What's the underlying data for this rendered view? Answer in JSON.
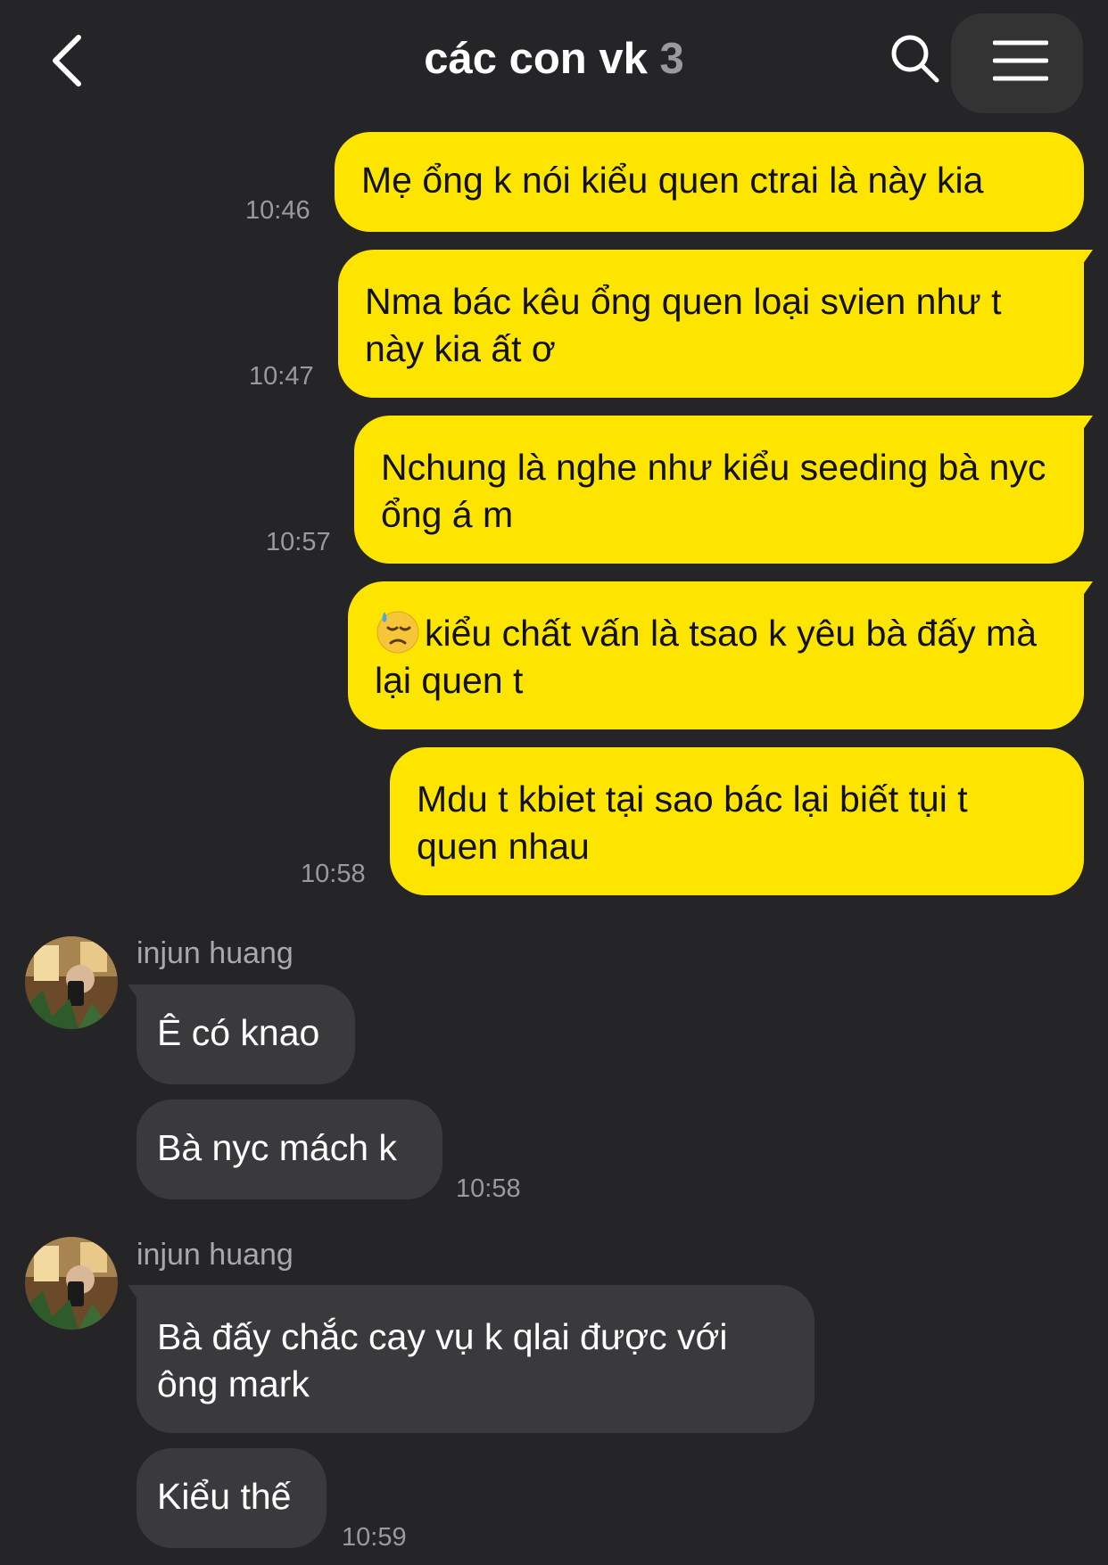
{
  "header": {
    "title": "các con vk",
    "member_count": "3",
    "back_icon": "chevron-left-icon",
    "search_icon": "search-icon",
    "menu_icon": "hamburger-menu-icon"
  },
  "colors": {
    "background": "#252527",
    "my_bubble": "#fee500",
    "their_bubble": "#3a3a3c",
    "timestamp": "#9a9a9c"
  },
  "messages": {
    "m1": {
      "text": "Mẹ ổng k nói kiểu quen ctrai là này kia",
      "time": "10:46"
    },
    "m2": {
      "text": "Nma bác kêu ổng quen loại svien như t này kia ất ơ",
      "time": "10:47"
    },
    "m3": {
      "text": "Nchung là nghe như kiểu seeding bà nyc ổng á m",
      "time": "10:57"
    },
    "m4": {
      "emoji": "downcast-face-with-sweat-emoji",
      "text": "kiểu chất vấn là tsao k yêu bà đấy mà lại quen t"
    },
    "m5": {
      "text": "Mdu t kbiet tại sao bác lại biết tụi t quen nhau",
      "time": "10:58"
    }
  },
  "group1": {
    "sender": "injun huang",
    "m1": {
      "text": "Ê có knao"
    },
    "m2": {
      "text": "Bà nyc mách k",
      "time": "10:58"
    }
  },
  "group2": {
    "sender": "injun huang",
    "m1": {
      "text": "Bà đấy chắc cay vụ k qlai được với ông mark"
    },
    "m2": {
      "text": "Kiểu thế",
      "time": "10:59"
    }
  }
}
